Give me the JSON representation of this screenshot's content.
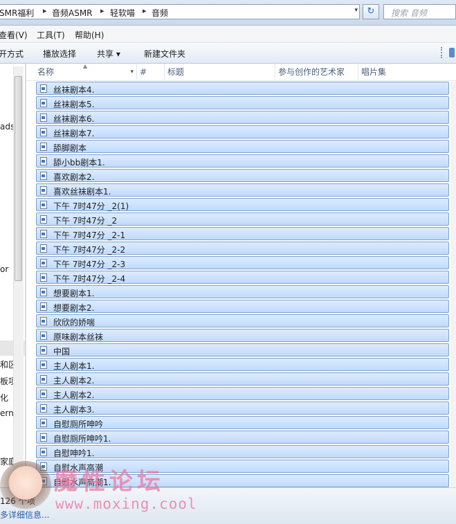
{
  "address": {
    "crumbs": [
      "SMR福利",
      "音频ASMR",
      "轻软喵",
      "音频"
    ],
    "separator": "▸",
    "dropdown": "▾",
    "refresh": "↻",
    "search_placeholder": "搜索 音频"
  },
  "menu": {
    "items": [
      "查看(V)",
      "工具(T)",
      "帮助(H)"
    ]
  },
  "toolbar": {
    "items": [
      "打开方式",
      "播放选择",
      "共享 ▾",
      "新建文件夹"
    ]
  },
  "nav": {
    "labels": [
      "ads",
      "or",
      "和区",
      "板项",
      "化",
      "erne",
      "家庭"
    ]
  },
  "columns": {
    "name": "名称",
    "number": "#",
    "title": "标题",
    "artist": "参与创作的艺术家",
    "album": "唱片集"
  },
  "files": [
    "丝袜剧本4.",
    "丝袜剧本5.",
    "丝袜剧本6.",
    "丝袜剧本7.",
    "舔脚剧本",
    "舔小bb剧本1.",
    "喜欢剧本2.",
    "喜欢丝袜剧本1.",
    "下午 7时47分 _2(1)",
    "下午 7时47分 _2",
    "下午 7时47分 _2-1",
    "下午 7时47分 _2-2",
    "下午 7时47分 _2-3",
    "下午 7时47分 _2-4",
    "想要剧本1.",
    "想要剧本2.",
    "欣欣的娇喘",
    "原味剧本丝袜",
    "中国",
    "主人剧本1.",
    "主人剧本2.",
    "主人剧本2.",
    "主人剧本3.",
    "自慰厕所呻吟",
    "自慰厕所呻吟1.",
    "自慰呻吟1.",
    "自慰水声高潮",
    "自慰水声高潮1."
  ],
  "status": {
    "count": "126 个项",
    "details": "多详细信息..."
  },
  "watermark": {
    "title": "魔性论坛",
    "url": "www.moxing.cool"
  }
}
